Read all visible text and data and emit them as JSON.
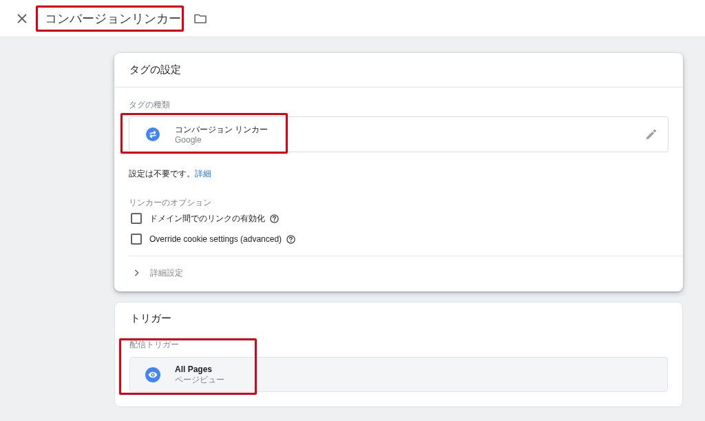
{
  "header": {
    "title": "コンバージョンリンカー",
    "highlighted": true
  },
  "tag_config": {
    "heading": "タグの設定",
    "type_label": "タグの種類",
    "tag_type": {
      "name": "コンバージョン リンカー",
      "vendor": "Google",
      "highlighted": true
    },
    "note": "設定は不要です。",
    "note_link": "詳細",
    "options_label": "リンカーのオプション",
    "options": [
      {
        "label": "ドメイン間でのリンクの有効化",
        "checked": false
      },
      {
        "label": "Override cookie settings (advanced)",
        "checked": false
      }
    ],
    "advanced": {
      "label": "詳細設定",
      "expanded": false
    }
  },
  "triggering": {
    "heading": "トリガー",
    "label": "配信トリガー",
    "highlighted": true,
    "triggers": [
      {
        "name": "All Pages",
        "type": "ページビュー"
      }
    ]
  }
}
